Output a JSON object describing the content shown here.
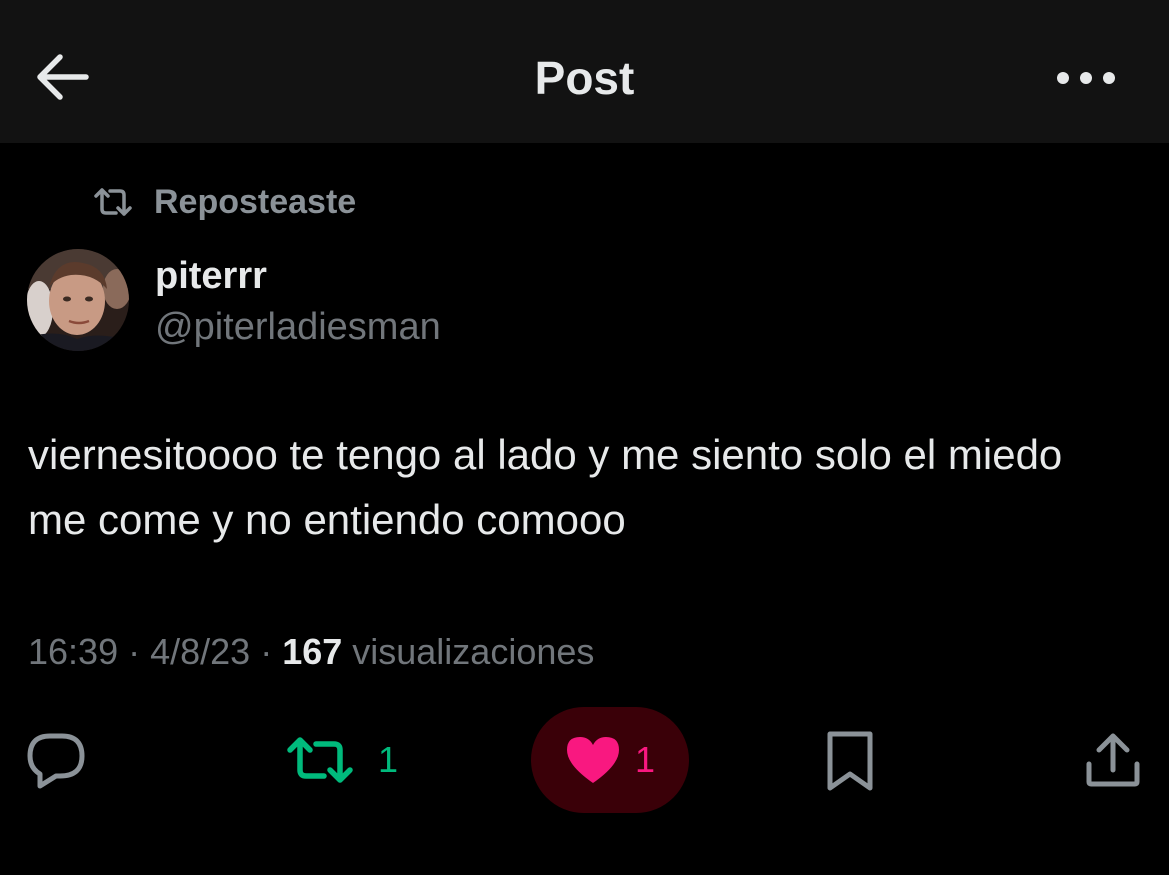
{
  "header": {
    "title": "Post",
    "back_icon": "arrow-left-icon",
    "more_icon": "more-horizontal-icon"
  },
  "repost_context": {
    "icon": "retweet-icon",
    "label": "Reposteaste"
  },
  "author": {
    "display_name": "piterrr",
    "handle": "@piterladiesman",
    "avatar": "profile-photo"
  },
  "post": {
    "text": "viernesitoooo te tengo al lado y me siento solo el miedo me come y no entiendo comooo"
  },
  "meta": {
    "time": "16:39",
    "separator": " · ",
    "date": "4/8/23",
    "views_count": "167",
    "views_label": " visualizaciones"
  },
  "actions": {
    "reply": {
      "icon": "reply-icon"
    },
    "retweet": {
      "icon": "retweet-icon",
      "count": "1",
      "active": true
    },
    "like": {
      "icon": "heart-icon",
      "count": "1",
      "active": true
    },
    "bookmark": {
      "icon": "bookmark-icon"
    },
    "share": {
      "icon": "share-icon"
    }
  },
  "colors": {
    "background": "#000000",
    "header_background": "#121212",
    "text_primary": "#e7e9ea",
    "text_secondary": "#71767b",
    "retweet_active": "#00ba7c",
    "like_active": "#f91880",
    "like_pill": "#3a0008"
  }
}
